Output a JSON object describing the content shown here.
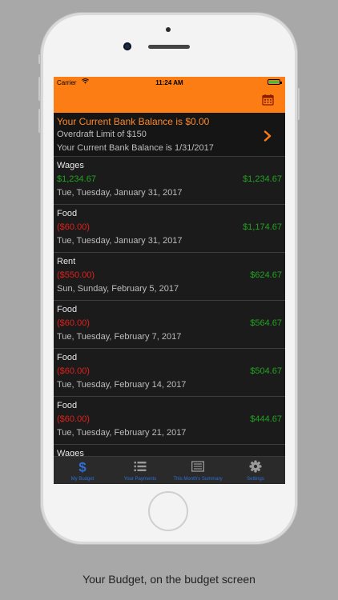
{
  "status_bar": {
    "carrier": "Carrier",
    "time": "11:24 AM"
  },
  "header": {
    "calendar_icon": "calendar-icon"
  },
  "balance": {
    "current_balance_text": "Your Current Bank Balance is  $0.00",
    "overdraft_text": "Overdraft Limit of   $150",
    "balance_date_text": "Your Current Bank Balance is 1/31/2017"
  },
  "transactions": [
    {
      "name": "Wages",
      "amount": "$1,234.67",
      "amount_type": "pos",
      "running": "$1,234.67",
      "date": "Tue, Tuesday, January 31, 2017"
    },
    {
      "name": "Food",
      "amount": "($60.00)",
      "amount_type": "neg",
      "running": "$1,174.67",
      "date": "Tue, Tuesday, January 31, 2017"
    },
    {
      "name": "Rent",
      "amount": "($550.00)",
      "amount_type": "neg",
      "running": "$624.67",
      "date": "Sun, Sunday, February 5, 2017"
    },
    {
      "name": "Food",
      "amount": "($60.00)",
      "amount_type": "neg",
      "running": "$564.67",
      "date": "Tue, Tuesday, February 7, 2017"
    },
    {
      "name": "Food",
      "amount": "($60.00)",
      "amount_type": "neg",
      "running": "$504.67",
      "date": "Tue, Tuesday, February 14, 2017"
    },
    {
      "name": "Food",
      "amount": "($60.00)",
      "amount_type": "neg",
      "running": "$444.67",
      "date": "Tue, Tuesday, February 21, 2017"
    },
    {
      "name": "Wages",
      "amount": "",
      "amount_type": "pos",
      "running": "",
      "date": ""
    }
  ],
  "tabs": [
    {
      "label": "My Budget",
      "icon": "dollar-icon"
    },
    {
      "label": "Your Payments",
      "icon": "list-icon"
    },
    {
      "label": "This Month's Summary",
      "icon": "summary-icon"
    },
    {
      "label": "Settings",
      "icon": "gear-icon"
    }
  ],
  "caption": "Your Budget, on the budget screen",
  "colors": {
    "accent": "#fb7d14",
    "positive": "#22a321",
    "negative": "#e0201d",
    "tab_active": "#2f6fd6"
  }
}
